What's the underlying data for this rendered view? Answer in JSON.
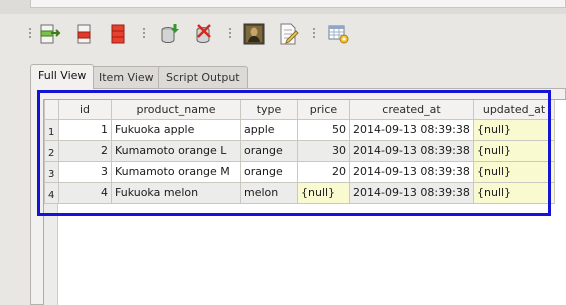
{
  "tabs": [
    {
      "label": "Full View",
      "active": true
    },
    {
      "label": "Item View",
      "active": false
    },
    {
      "label": "Script Output",
      "active": false
    }
  ],
  "toolbar": {
    "buttons": [
      {
        "icon": "insert-row-icon"
      },
      {
        "icon": "delete-row-icon"
      },
      {
        "icon": "delete-all-rows-icon"
      },
      {
        "icon": "save-to-db-icon"
      },
      {
        "icon": "delete-from-db-icon"
      },
      {
        "icon": "image-viewer-icon"
      },
      {
        "icon": "edit-document-icon"
      },
      {
        "icon": "table-settings-icon"
      }
    ]
  },
  "grid": {
    "columns": [
      "id",
      "product_name",
      "type",
      "price",
      "created_at",
      "updated_at"
    ],
    "rows": [
      {
        "num": "1",
        "id": "1",
        "product_name": "Fukuoka apple",
        "type": "apple",
        "price": "50",
        "created_at": "2014-09-13 08:39:38",
        "updated_at": "{null}"
      },
      {
        "num": "2",
        "id": "2",
        "product_name": "Kumamoto orange L",
        "type": "orange",
        "price": "30",
        "created_at": "2014-09-13 08:39:38",
        "updated_at": "{null}"
      },
      {
        "num": "3",
        "id": "3",
        "product_name": "Kumamoto orange M",
        "type": "orange",
        "price": "20",
        "created_at": "2014-09-13 08:39:38",
        "updated_at": "{null}"
      },
      {
        "num": "4",
        "id": "4",
        "product_name": "Fukuoka melon",
        "type": "melon",
        "price": "{null}",
        "created_at": "2014-09-13 08:39:38",
        "updated_at": "{null}"
      }
    ]
  },
  "colors": {
    "selection_border": "#1414d6",
    "null_cell": "#fafad0",
    "alt_row": "#ececea"
  }
}
